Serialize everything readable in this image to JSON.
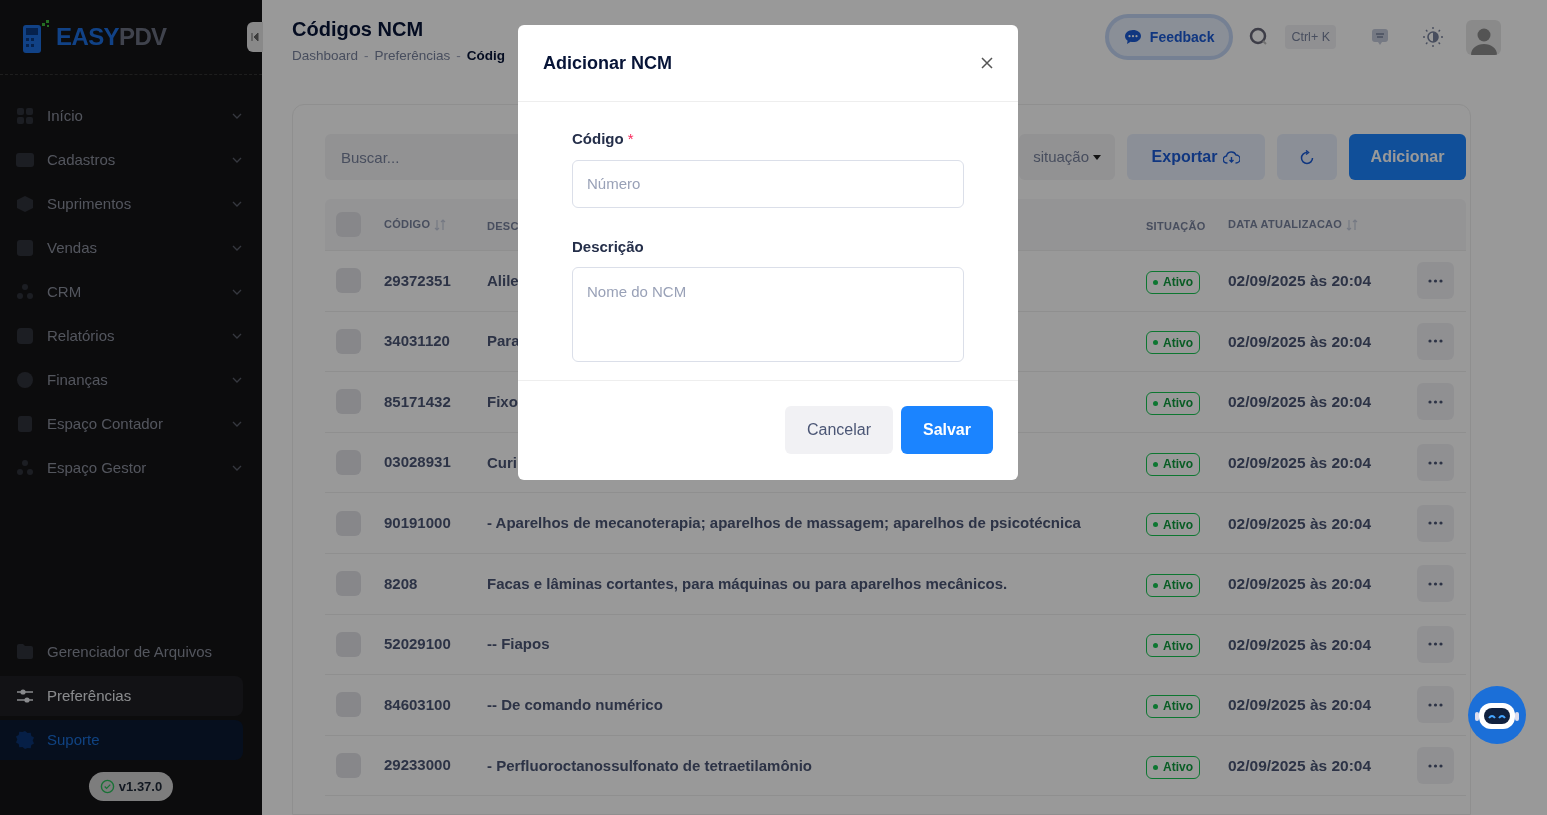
{
  "sidebar": {
    "logo": {
      "part_1": "EASY",
      "part_2": "PDV"
    },
    "items": [
      {
        "label": "Início",
        "expanded": false
      },
      {
        "label": "Cadastros",
        "expanded": false
      },
      {
        "label": "Suprimentos",
        "expanded": false
      },
      {
        "label": "Vendas",
        "expanded": false
      },
      {
        "label": "CRM",
        "expanded": false
      },
      {
        "label": "Relatórios",
        "expanded": false
      },
      {
        "label": "Finanças",
        "expanded": false
      },
      {
        "label": "Espaço Contador",
        "expanded": false
      },
      {
        "label": "Espaço Gestor",
        "expanded": false
      }
    ],
    "bottom_items": [
      {
        "label": "Gerenciador de Arquivos",
        "kind": "files",
        "selected": false
      },
      {
        "label": "Preferências",
        "kind": "settings",
        "selected": true
      },
      {
        "label": "Suporte",
        "kind": "support",
        "selected": false
      }
    ],
    "version": "v1.37.0"
  },
  "header": {
    "title": "Códigos NCM",
    "breadcrumb": [
      "Dashboard",
      "Preferências",
      "Códig"
    ],
    "breadcrumb_separator": "-",
    "feedback": "Feedback",
    "shortcut": "Ctrl+ K"
  },
  "toolbar": {
    "search_placeholder": "Buscar...",
    "filter": "situação",
    "export": "Exportar",
    "add": "Adicionar"
  },
  "table": {
    "select_all_checked": false,
    "columns": [
      "CÓDIGO",
      "DESC",
      "SITUAÇÃO",
      "DATA ATUALIZACAO"
    ],
    "rows": [
      {
        "checked": false,
        "code": "29372351",
        "description": "Alile",
        "status": "Ativo",
        "updated": "02/09/2025 às 20:04"
      },
      {
        "checked": false,
        "code": "34031120",
        "description": "Para",
        "status": "Ativo",
        "updated": "02/09/2025 às 20:04"
      },
      {
        "checked": false,
        "code": "85171432",
        "description": "Fixo",
        "status": "Ativo",
        "updated": "02/09/2025 às 20:04"
      },
      {
        "checked": false,
        "code": "03028931",
        "description": "Curi",
        "status": "Ativo",
        "updated": "02/09/2025 às 20:04"
      },
      {
        "checked": false,
        "code": "90191000",
        "description": "- Aparelhos de mecanoterapia; aparelhos de massagem; aparelhos de psicotécnica",
        "status": "Ativo",
        "updated": "02/09/2025 às 20:04"
      },
      {
        "checked": false,
        "code": "8208",
        "description": "Facas e lâminas cortantes, para máquinas ou para aparelhos mecânicos.",
        "status": "Ativo",
        "updated": "02/09/2025 às 20:04"
      },
      {
        "checked": false,
        "code": "52029100",
        "description": "-- Fiapos",
        "status": "Ativo",
        "updated": "02/09/2025 às 20:04"
      },
      {
        "checked": false,
        "code": "84603100",
        "description": "-- De comando numérico",
        "status": "Ativo",
        "updated": "02/09/2025 às 20:04"
      },
      {
        "checked": false,
        "code": "29233000",
        "description": "- Perfluoroctanossulfonato de tetraetilamônio",
        "status": "Ativo",
        "updated": "02/09/2025 às 20:04"
      }
    ]
  },
  "modal": {
    "title": "Adicionar NCM",
    "fields": [
      {
        "label": "Código",
        "required_mark": "*",
        "kind": "input",
        "placeholder": "Número"
      },
      {
        "label": "Descrição",
        "kind": "textarea",
        "placeholder": "Nome do NCM"
      }
    ],
    "buttons": [
      "Cancelar",
      "Salvar"
    ]
  }
}
